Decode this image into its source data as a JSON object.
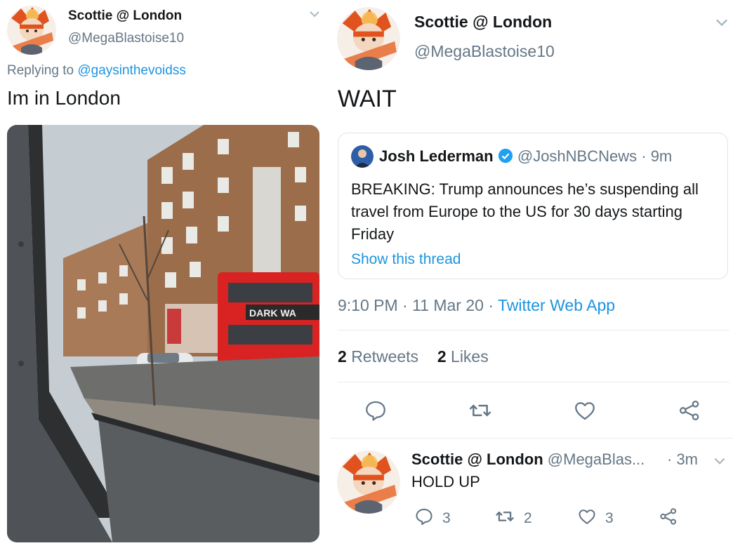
{
  "colors": {
    "link": "#1b95e0",
    "secondary_text": "#657786",
    "icon_gray": "#657786",
    "divider": "#e6ecf0",
    "bus_red": "#d92323"
  },
  "left_tweet": {
    "author_name": "Scottie @ London",
    "author_handle": "@MegaBlastoise10",
    "replying_prefix": "Replying to ",
    "replying_handle": "@gaysinthevoidss",
    "text": "Im in London",
    "photo": {
      "sign_text": "DARK WA"
    }
  },
  "main_tweet": {
    "author_name": "Scottie @ London",
    "author_handle": "@MegaBlastoise10",
    "text": "WAIT",
    "quoted": {
      "author_name": "Josh Lederman",
      "author_handle": "@JoshNBCNews",
      "time": "· 9m",
      "text": "BREAKING: Trump announces he’s suspending all travel from Europe to the US for 30 days starting Friday",
      "show_thread": "Show this thread"
    },
    "timestamp": "9:10 PM · 11 Mar 20 ·",
    "source": "Twitter Web App",
    "retweets_count": "2",
    "retweets_label": "Retweets",
    "likes_count": "2",
    "likes_label": "Likes",
    "actions": [
      "reply-icon",
      "retweet-icon",
      "like-icon",
      "share-icon"
    ]
  },
  "reply_tweet": {
    "author_name": "Scottie @ London",
    "author_handle": "@MegaBlas...",
    "time": "· 3m",
    "text": "HOLD UP",
    "reply_count": "3",
    "retweet_count": "2",
    "like_count": "3"
  }
}
